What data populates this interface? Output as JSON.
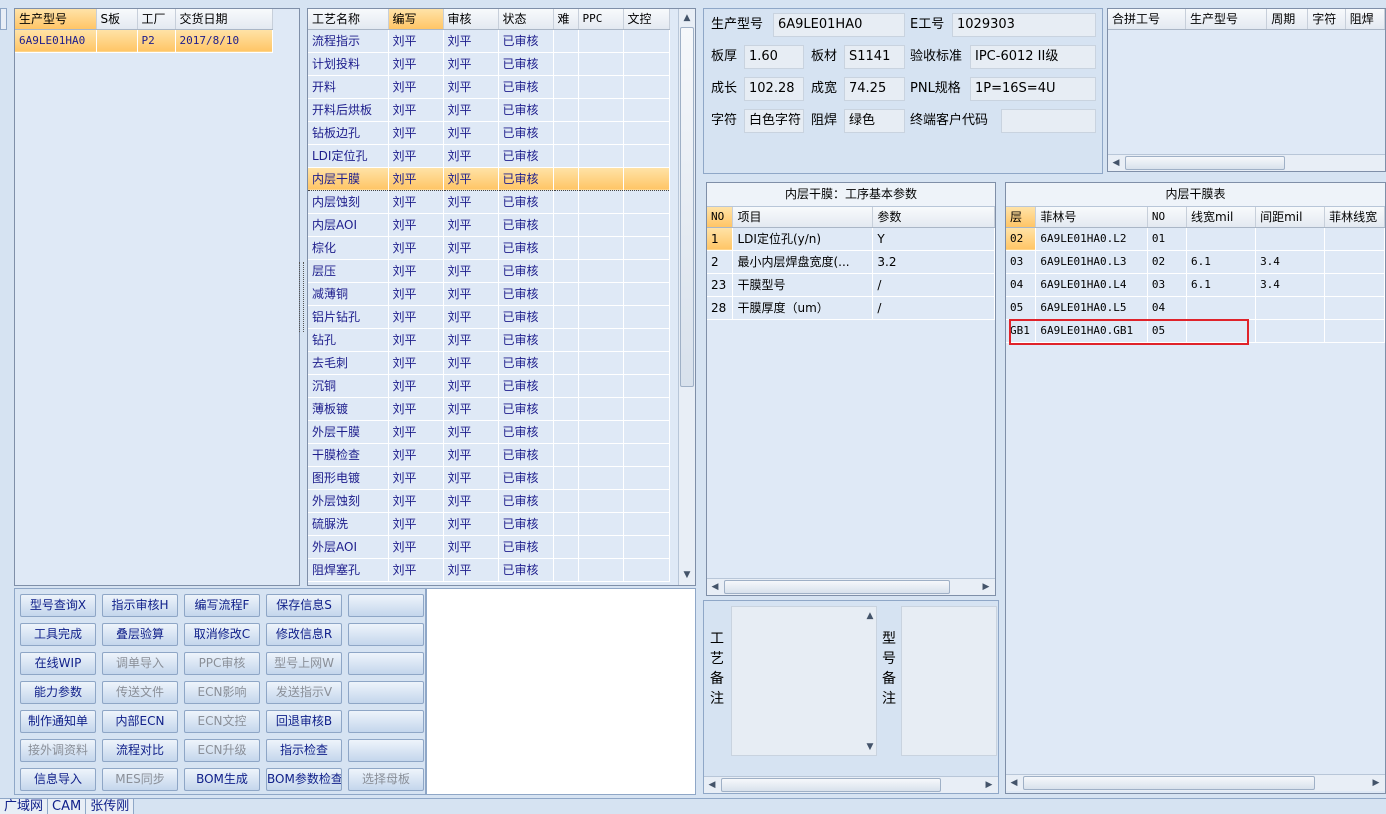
{
  "left_grid": {
    "columns": [
      "生产型号",
      "S板",
      "工厂",
      "交货日期"
    ],
    "rows": [
      [
        "6A9LE01HA0",
        "",
        "P2",
        "2017/8/10"
      ]
    ]
  },
  "process_grid": {
    "columns": [
      "工艺名称",
      "编写",
      "审核",
      "状态",
      "难",
      "PPC",
      "文控"
    ],
    "selected_row": 6,
    "rows": [
      [
        "流程指示",
        "刘平",
        "刘平",
        "已审核"
      ],
      [
        "计划投料",
        "刘平",
        "刘平",
        "已审核"
      ],
      [
        "开料",
        "刘平",
        "刘平",
        "已审核"
      ],
      [
        "开料后烘板",
        "刘平",
        "刘平",
        "已审核"
      ],
      [
        "钻板边孔",
        "刘平",
        "刘平",
        "已审核"
      ],
      [
        "LDI定位孔",
        "刘平",
        "刘平",
        "已审核"
      ],
      [
        "内层干膜",
        "刘平",
        "刘平",
        "已审核"
      ],
      [
        "内层蚀刻",
        "刘平",
        "刘平",
        "已审核"
      ],
      [
        "内层AOI",
        "刘平",
        "刘平",
        "已审核"
      ],
      [
        "棕化",
        "刘平",
        "刘平",
        "已审核"
      ],
      [
        "层压",
        "刘平",
        "刘平",
        "已审核"
      ],
      [
        "减薄铜",
        "刘平",
        "刘平",
        "已审核"
      ],
      [
        "铝片钻孔",
        "刘平",
        "刘平",
        "已审核"
      ],
      [
        "钻孔",
        "刘平",
        "刘平",
        "已审核"
      ],
      [
        "去毛刺",
        "刘平",
        "刘平",
        "已审核"
      ],
      [
        "沉铜",
        "刘平",
        "刘平",
        "已审核"
      ],
      [
        "薄板镀",
        "刘平",
        "刘平",
        "已审核"
      ],
      [
        "外层干膜",
        "刘平",
        "刘平",
        "已审核"
      ],
      [
        "干膜检查",
        "刘平",
        "刘平",
        "已审核"
      ],
      [
        "图形电镀",
        "刘平",
        "刘平",
        "已审核"
      ],
      [
        "外层蚀刻",
        "刘平",
        "刘平",
        "已审核"
      ],
      [
        "硫脲洗",
        "刘平",
        "刘平",
        "已审核"
      ],
      [
        "外层AOI",
        "刘平",
        "刘平",
        "已审核"
      ],
      [
        "阻焊塞孔",
        "刘平",
        "刘平",
        "已审核"
      ]
    ]
  },
  "buttons": [
    [
      "型号查询X",
      "指示审核H",
      "编写流程F",
      "保存信息S",
      ""
    ],
    [
      "工具完成",
      "叠层验算",
      "取消修改C",
      "修改信息R",
      ""
    ],
    [
      "在线WIP",
      "调单导入",
      "PPC审核",
      "型号上网W",
      ""
    ],
    [
      "能力参数",
      "传送文件",
      "ECN影响",
      "发送指示V",
      ""
    ],
    [
      "制作通知单",
      "内部ECN",
      "ECN文控",
      "回退审核B",
      ""
    ],
    [
      "接外调资料",
      "流程对比",
      "ECN升级",
      "指示检查",
      ""
    ],
    [
      "信息导入",
      "MES同步",
      "BOM生成",
      "BOM参数检查",
      "选择母板"
    ]
  ],
  "info": {
    "prod_model_label": "生产型号",
    "prod_model": "6A9LE01HA0",
    "e_no_label": "E工号",
    "e_no": "1029303",
    "thickness_label": "板厚",
    "thickness": "1.60",
    "material_label": "板材",
    "material": "S1141",
    "accept_label": "验收标准",
    "accept": "IPC-6012 II级",
    "length_label": "成长",
    "length": "102.28",
    "width_label": "成宽",
    "width": "74.25",
    "pnl_label": "PNL规格",
    "pnl": "1P=16S=4U",
    "char_label": "字符",
    "char": "白色字符",
    "solder_label": "阻焊",
    "solder": "绿色",
    "customer_label": "终端客户代码",
    "customer": ""
  },
  "merge_grid": {
    "columns": [
      "合拼工号",
      "生产型号",
      "周期",
      "字符",
      "阻焊"
    ]
  },
  "params_panel": {
    "title": "内层干膜：工序基本参数",
    "columns": [
      "NO",
      "项目",
      "参数"
    ],
    "rows": [
      [
        "1",
        "LDI定位孔(y/n)",
        "Y"
      ],
      [
        "2",
        "最小内层焊盘宽度(...",
        "3.2"
      ],
      [
        "23",
        "干膜型号",
        "/"
      ],
      [
        "28",
        "干膜厚度（um）",
        "/"
      ]
    ]
  },
  "film_panel": {
    "title": "内层干膜表",
    "columns": [
      "层",
      "菲林号",
      "NO",
      "线宽mil",
      "间距mil",
      "菲林线宽"
    ],
    "rows": [
      [
        "02",
        "6A9LE01HA0.L2",
        "01",
        "",
        ""
      ],
      [
        "03",
        "6A9LE01HA0.L3",
        "02",
        "6.1",
        "3.4"
      ],
      [
        "04",
        "6A9LE01HA0.L4",
        "03",
        "6.1",
        "3.4"
      ],
      [
        "05",
        "6A9LE01HA0.L5",
        "04",
        "",
        ""
      ],
      [
        "GB1",
        "6A9LE01HA0.GB1",
        "05",
        "",
        ""
      ]
    ]
  },
  "remarks": {
    "process_label": "工艺备注",
    "model_label": "型号备注"
  },
  "status_bar": [
    "广域网",
    "CAM",
    "张传刚"
  ],
  "colors": {
    "highlight": "#ffc566",
    "grid_bg": "#dfe9f6",
    "red_box": "#e0232a"
  }
}
